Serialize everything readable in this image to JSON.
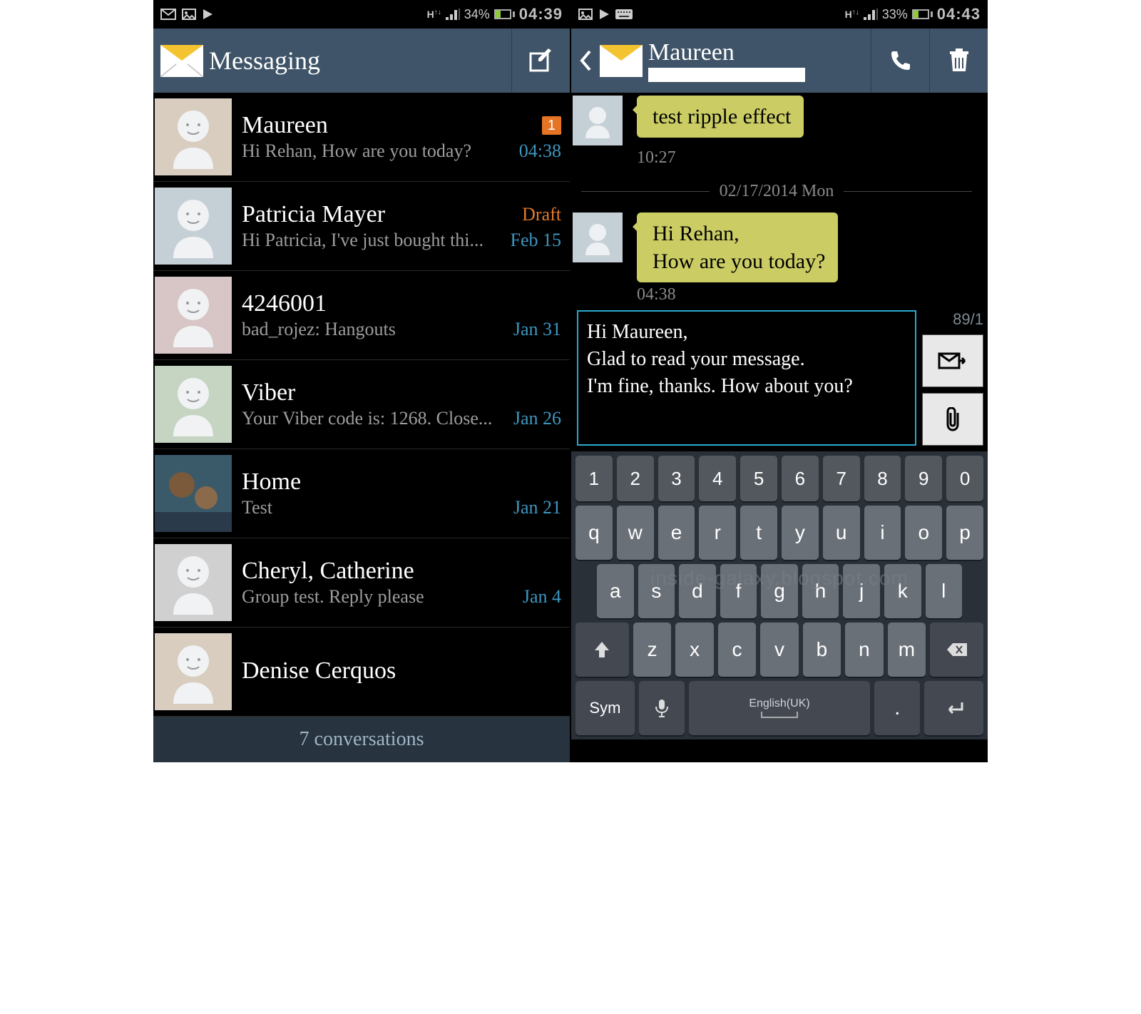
{
  "left": {
    "status": {
      "battery": "34%",
      "time": "04:39"
    },
    "appbar": {
      "title": "Messaging"
    },
    "conversations": [
      {
        "name": "Maureen",
        "preview": "Hi Rehan, How are you today?",
        "time": "04:38",
        "unread": "1",
        "avatar": "warm"
      },
      {
        "name": "Patricia Mayer",
        "preview": "Hi Patricia, I've just bought thi...",
        "time": "Feb 15",
        "draft": "Draft",
        "avatar": "cool"
      },
      {
        "name": "4246001",
        "preview": "bad_rojez: Hangouts",
        "time": "Jan 31",
        "avatar": "pink"
      },
      {
        "name": "Viber",
        "preview": "Your Viber code is: 1268. Close...",
        "time": "Jan 26",
        "avatar": "green"
      },
      {
        "name": "Home",
        "preview": "Test",
        "time": "Jan 21",
        "avatar": "photo"
      },
      {
        "name": "Cheryl, Catherine",
        "preview": "Group test. Reply please",
        "time": "Jan 4",
        "avatar": "gray"
      },
      {
        "name": "Denise Cerquos",
        "preview": "",
        "time": "",
        "avatar": "warm"
      }
    ],
    "footer": "7 conversations"
  },
  "right": {
    "status": {
      "battery": "33%",
      "time": "04:43"
    },
    "appbar": {
      "contact": "Maureen"
    },
    "messages": [
      {
        "text": "test ripple effect",
        "time": "10:27"
      }
    ],
    "dateSep": "02/17/2014 Mon",
    "messages2": [
      {
        "text": "Hi Rehan,\nHow are you today?",
        "time": "04:38"
      }
    ],
    "compose": {
      "text": "Hi Maureen,\nGlad to read your message.\nI'm fine, thanks. How about you?",
      "counter": "89/1"
    },
    "keyboard": {
      "row1": [
        "1",
        "2",
        "3",
        "4",
        "5",
        "6",
        "7",
        "8",
        "9",
        "0"
      ],
      "row2": [
        "q",
        "w",
        "e",
        "r",
        "t",
        "y",
        "u",
        "i",
        "o",
        "p"
      ],
      "row3": [
        "a",
        "s",
        "d",
        "f",
        "g",
        "h",
        "j",
        "k",
        "l"
      ],
      "row4": [
        "z",
        "x",
        "c",
        "v",
        "b",
        "n",
        "m"
      ],
      "sym": "Sym",
      "lang": "English(UK)"
    }
  },
  "watermark": "inside-galaxy.blogspot.com"
}
